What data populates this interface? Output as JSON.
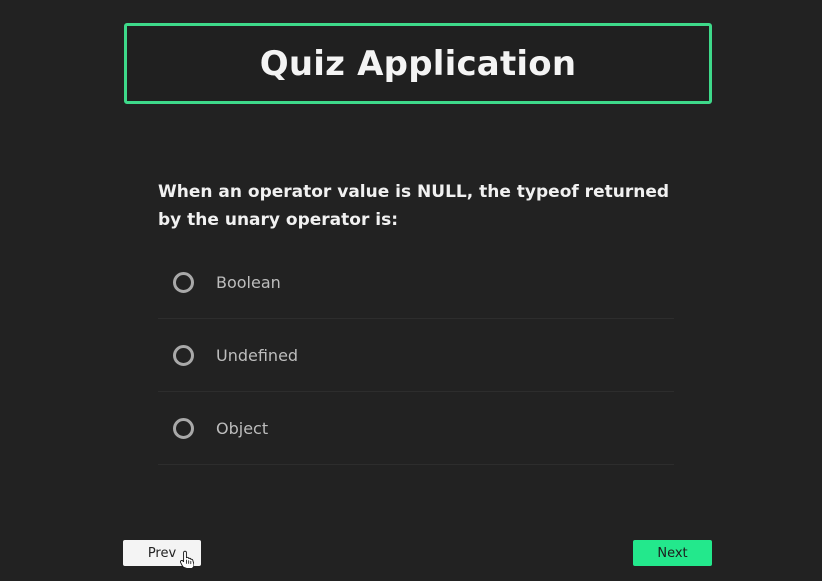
{
  "header": {
    "title": "Quiz Application"
  },
  "quiz": {
    "question": "When an operator value is NULL, the typeof returned by the unary operator is:",
    "options": [
      {
        "label": "Boolean",
        "selected": false
      },
      {
        "label": "Undefined",
        "selected": false
      },
      {
        "label": "Object",
        "selected": false
      }
    ]
  },
  "nav": {
    "prev_label": "Prev",
    "next_label": "Next"
  },
  "colors": {
    "background": "#222222",
    "accent": "#3ed98a",
    "next_button": "#23e88c",
    "prev_button": "#f4f4f4"
  },
  "icons": {
    "cursor": "hand-pointer-icon",
    "radio": "radio-unchecked-icon"
  }
}
